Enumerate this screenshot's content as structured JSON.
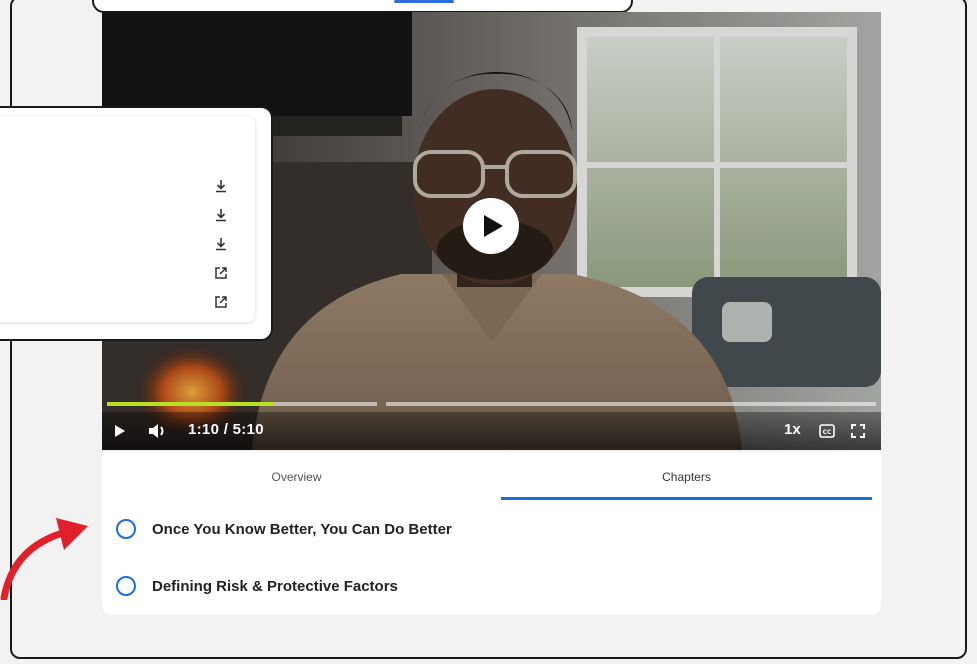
{
  "player": {
    "time": "1:10 / 5:10",
    "speed": "1x",
    "progress_fraction": 0.62
  },
  "popup": {
    "actions": [
      {
        "icon": "download-icon"
      },
      {
        "icon": "download-icon"
      },
      {
        "icon": "download-icon"
      },
      {
        "icon": "external-link-icon"
      },
      {
        "icon": "external-link-icon"
      }
    ]
  },
  "tabs": [
    {
      "label": "Overview",
      "active": false
    },
    {
      "label": "Chapters",
      "active": true
    }
  ],
  "chapters": [
    {
      "label": "Once You Know Better, You Can Do Better"
    },
    {
      "label": "Defining Risk & Protective Factors"
    }
  ],
  "colors": {
    "accent": "#1f6ee0",
    "progress": "#b8e024",
    "annotation_arrow": "#e0202a"
  }
}
